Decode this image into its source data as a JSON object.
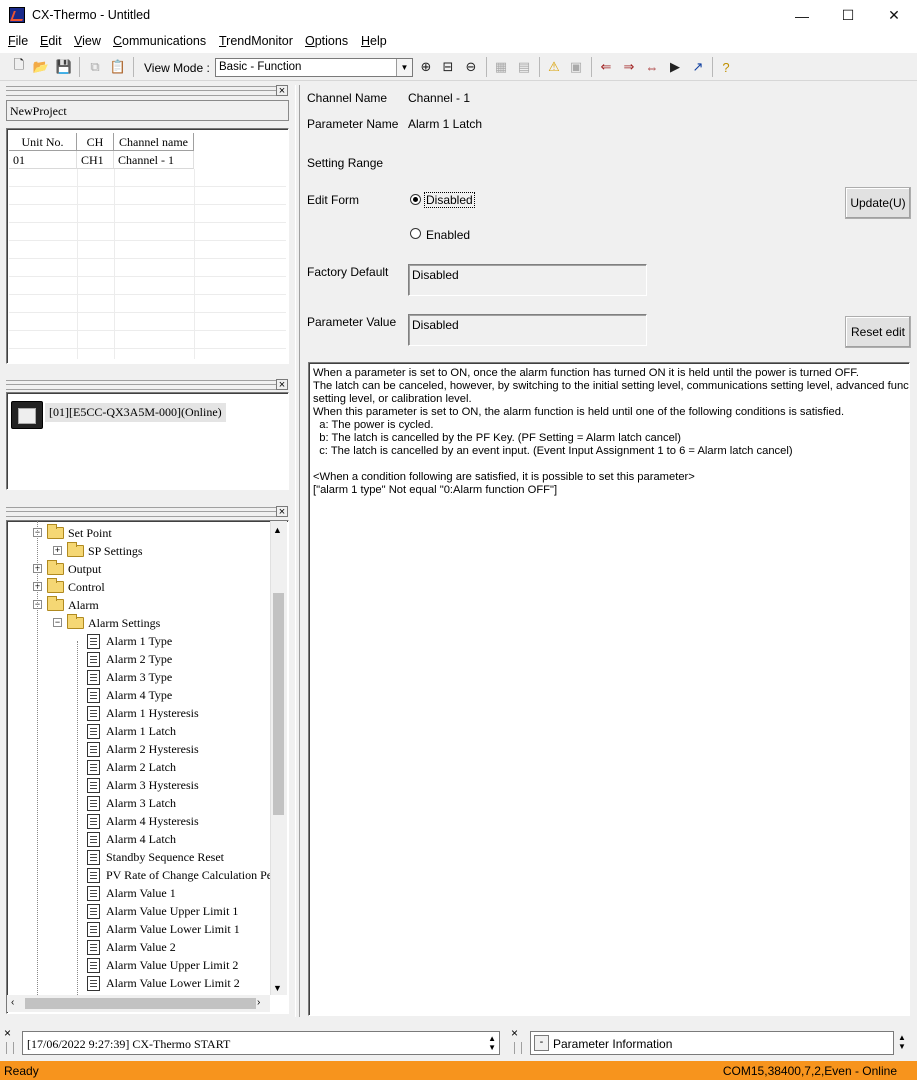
{
  "window": {
    "title": "CX-Thermo - Untitled",
    "minimize": "—",
    "maximize": "☐",
    "close": "✕"
  },
  "menu": [
    "File",
    "Edit",
    "View",
    "Communications",
    "TrendMonitor",
    "Options",
    "Help"
  ],
  "toolbar": {
    "view_mode_label": "View Mode :",
    "view_mode_value": "Basic - Function"
  },
  "project": {
    "name": "NewProject"
  },
  "unit_table": {
    "headers": [
      "Unit No.",
      "CH",
      "Channel name"
    ],
    "rows": [
      {
        "unit": "01",
        "ch": "CH1",
        "name": "Channel - 1"
      }
    ]
  },
  "device": {
    "label": "[01][E5CC-QX3A5M-000](Online)"
  },
  "tree": {
    "nodes": [
      {
        "label": "Set Point",
        "type": "folder",
        "level": 0,
        "expander": "−"
      },
      {
        "label": "SP Settings",
        "type": "folder",
        "level": 1,
        "expander": "+"
      },
      {
        "label": "Output",
        "type": "folder",
        "level": 0,
        "expander": "+"
      },
      {
        "label": "Control",
        "type": "folder",
        "level": 0,
        "expander": "+"
      },
      {
        "label": "Alarm",
        "type": "folder",
        "level": 0,
        "expander": "−"
      },
      {
        "label": "Alarm Settings",
        "type": "folder",
        "level": 1,
        "expander": "−"
      },
      {
        "label": "Alarm 1 Type",
        "type": "doc",
        "level": 2
      },
      {
        "label": "Alarm 2 Type",
        "type": "doc",
        "level": 2
      },
      {
        "label": "Alarm 3 Type",
        "type": "doc",
        "level": 2
      },
      {
        "label": "Alarm 4 Type",
        "type": "doc",
        "level": 2
      },
      {
        "label": "Alarm 1 Hysteresis",
        "type": "doc",
        "level": 2
      },
      {
        "label": "Alarm 1 Latch",
        "type": "doc",
        "level": 2
      },
      {
        "label": "Alarm 2 Hysteresis",
        "type": "doc",
        "level": 2
      },
      {
        "label": "Alarm 2 Latch",
        "type": "doc",
        "level": 2
      },
      {
        "label": "Alarm 3 Hysteresis",
        "type": "doc",
        "level": 2
      },
      {
        "label": "Alarm 3 Latch",
        "type": "doc",
        "level": 2
      },
      {
        "label": "Alarm 4 Hysteresis",
        "type": "doc",
        "level": 2
      },
      {
        "label": "Alarm 4 Latch",
        "type": "doc",
        "level": 2
      },
      {
        "label": "Standby Sequence Reset",
        "type": "doc",
        "level": 2
      },
      {
        "label": "PV Rate of Change Calculation Pe",
        "type": "doc",
        "level": 2
      },
      {
        "label": "Alarm Value 1",
        "type": "doc",
        "level": 2
      },
      {
        "label": "Alarm Value Upper Limit 1",
        "type": "doc",
        "level": 2
      },
      {
        "label": "Alarm Value Lower Limit 1",
        "type": "doc",
        "level": 2
      },
      {
        "label": "Alarm Value 2",
        "type": "doc",
        "level": 2
      },
      {
        "label": "Alarm Value Upper Limit 2",
        "type": "doc",
        "level": 2
      },
      {
        "label": "Alarm Value Lower Limit 2",
        "type": "doc",
        "level": 2
      }
    ]
  },
  "params": {
    "channel_name_label": "Channel Name",
    "channel_name_value": "Channel - 1",
    "parameter_name_label": "Parameter Name",
    "parameter_name_value": "Alarm 1 Latch",
    "setting_range_label": "Setting Range",
    "edit_form_label": "Edit Form",
    "option_disabled": "Disabled",
    "option_enabled": "Enabled",
    "update_button": "Update(U)",
    "factory_default_label": "Factory Default",
    "factory_default_value": "Disabled",
    "parameter_value_label": "Parameter Value",
    "parameter_value": "Disabled",
    "reset_button": "Reset edit"
  },
  "description": "When a parameter is set to ON, once the alarm function has turned ON it is held until the power is turned OFF.\nThe latch can be canceled, however, by switching to the initial setting level, communications setting level, advanced function\nsetting level, or calibration level.\nWhen this parameter is set to ON, the alarm function is held until one of the following conditions is satisfied.\n  a: The power is cycled.\n  b: The latch is cancelled by the PF Key. (PF Setting = Alarm latch cancel)\n  c: The latch is cancelled by an event input. (Event Input Assignment 1 to 6 = Alarm latch cancel)\n\n<When a condition following are satisfied, it is possible to set this parameter>\n[\"alarm 1 type\" Not equal \"0:Alarm function OFF\"]",
  "log": {
    "entry": "[17/06/2022 9:27:39] CX-Thermo START"
  },
  "info": {
    "toggle": "-",
    "title": "Parameter Information"
  },
  "status": {
    "left": "Ready",
    "right": "COM15,38400,7,2,Even - Online"
  },
  "colors": {
    "statusbar": "#f7941d",
    "accent": "#0078d7"
  }
}
